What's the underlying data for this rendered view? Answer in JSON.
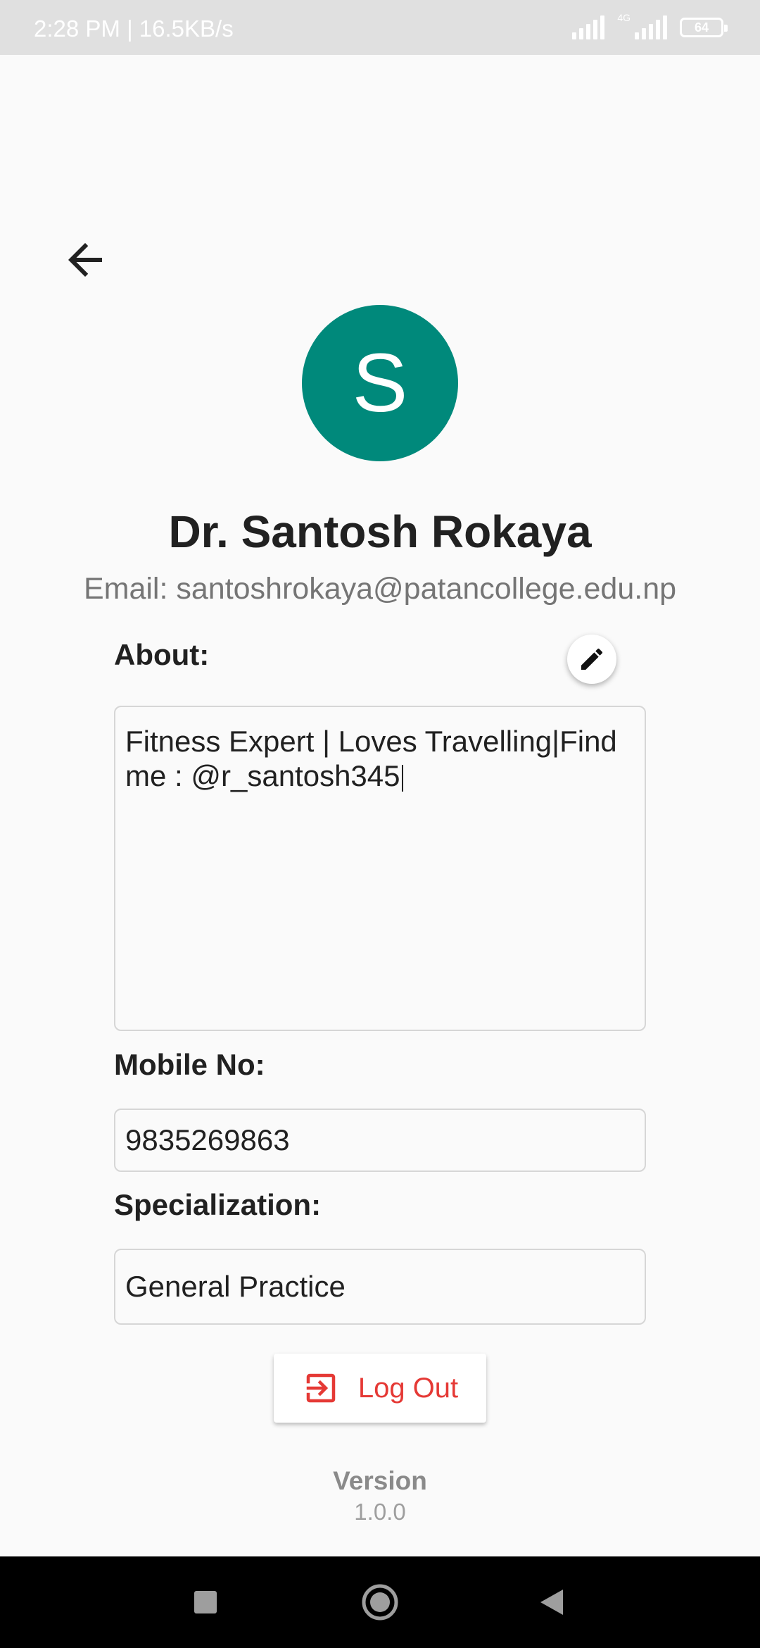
{
  "status_bar": {
    "time": "2:28 PM | 16.5KB/s",
    "network": "4G",
    "battery": "64"
  },
  "profile": {
    "avatar_letter": "S",
    "name": "Dr. Santosh Rokaya",
    "email": "Email: santoshrokaya@patancollege.edu.np",
    "avatar_color": "#00897b"
  },
  "about": {
    "label": "About:",
    "line1": "Fitness Expert | Loves Travelling|Find",
    "line2": "me : @r_santosh345"
  },
  "mobile": {
    "label": "Mobile No:",
    "value": "9835269863"
  },
  "specialization": {
    "label": "Specialization:",
    "value": "General Practice"
  },
  "logout": {
    "label": "Log Out",
    "color": "#e53935"
  },
  "version": {
    "label": "Version",
    "number": "1.0.0"
  },
  "icons": {
    "back": "arrow-back-icon",
    "edit": "pencil-icon",
    "logout": "logout-icon",
    "nav_recents": "square-icon",
    "nav_home": "circle-icon",
    "nav_back": "triangle-back-icon"
  }
}
